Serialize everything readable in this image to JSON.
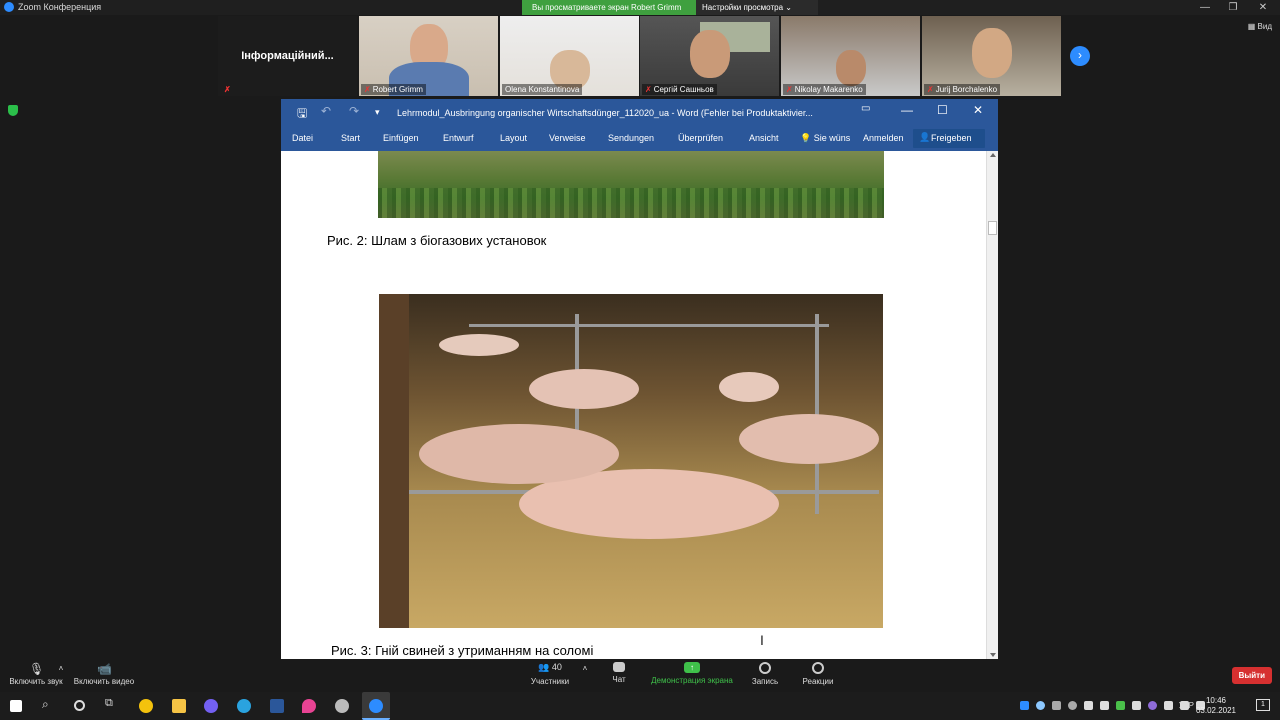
{
  "zoom": {
    "window_title": "Zoom Конференция",
    "share_banner": "Вы просматриваете экран Robert Grimm",
    "view_options": "Настройки просмотра",
    "view_toggle": "Вид"
  },
  "participants": [
    {
      "name": "Інформаційний...",
      "video": false,
      "muted": false
    },
    {
      "name": "Robert Grimm",
      "video": true,
      "muted": true
    },
    {
      "name": "Olena Konstantinova",
      "video": true,
      "muted": false
    },
    {
      "name": "Сергій Сашньов",
      "video": true,
      "muted": true
    },
    {
      "name": "Nikolay Makarenko",
      "video": true,
      "muted": true
    },
    {
      "name": "Jurij Borchalenko",
      "video": true,
      "muted": true
    }
  ],
  "word": {
    "doc_title": "Lehrmodul_Ausbringung organischer Wirtschaftsdünger_112020_ua - Word (Fehler bei Produktaktivier...",
    "tabs": [
      "Datei",
      "Start",
      "Einfügen",
      "Entwurf",
      "Layout",
      "Verweise",
      "Sendungen",
      "Überprüfen",
      "Ansicht"
    ],
    "tell_me": "Sie wüns",
    "signin": "Anmelden",
    "share": "Freigeben",
    "caption_fig2": "Рис. 2: Шлам з біогазових установок",
    "caption_fig3": "Рис. 3: Гній свиней з утриманням на соломі"
  },
  "toolbar": {
    "mute": "Включить звук",
    "video": "Включить видео",
    "participants": "Участники",
    "participant_count": "40",
    "chat": "Чат",
    "share": "Демонстрация экрана",
    "record": "Запись",
    "reactions": "Реакции",
    "leave": "Выйти"
  },
  "taskbar": {
    "lang": "УКР",
    "time": "10:46",
    "date": "03.02.2021",
    "notifications": "1"
  },
  "colors": {
    "word_blue": "#2b579a",
    "zoom_blue": "#2d8cff",
    "share_green": "#3fa03f",
    "leave_red": "#d63030"
  }
}
